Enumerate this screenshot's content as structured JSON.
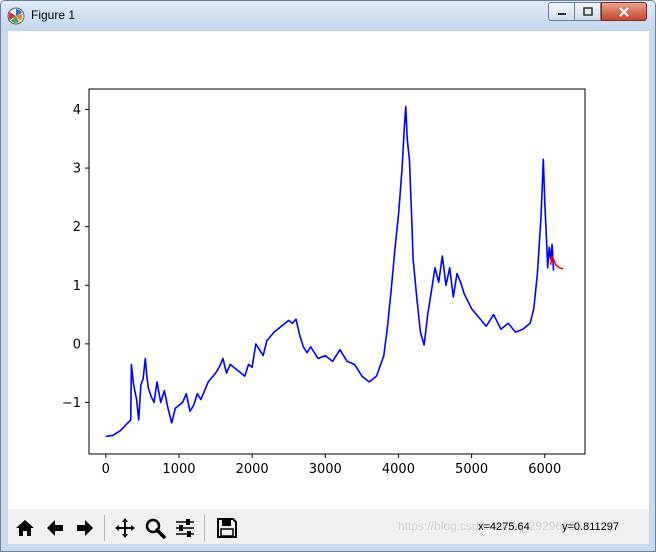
{
  "window": {
    "title": "Figure 1",
    "app_icon": "matplotlib-icon",
    "controls": [
      "minimize-icon",
      "maximize-icon",
      "close-icon"
    ]
  },
  "toolbar": {
    "buttons": [
      "home-icon",
      "back-arrow-icon",
      "forward-arrow-icon",
      "pan-icon",
      "zoom-icon",
      "configure-subplots-icon",
      "save-icon"
    ],
    "coord_x": "x=4275.64",
    "coord_y": "y=0.811297",
    "watermark": "https://blog.csdn.net/qq_29296886"
  },
  "chart_data": {
    "type": "line",
    "title": "",
    "xlabel": "",
    "ylabel": "",
    "xlim": [
      -230,
      6550
    ],
    "ylim": [
      -1.88,
      4.35
    ],
    "xticks": [
      0,
      1000,
      2000,
      3000,
      4000,
      5000,
      6000
    ],
    "yticks": [
      -1,
      0,
      1,
      2,
      3,
      4
    ],
    "xtick_labels": [
      "0",
      "1000",
      "2000",
      "3000",
      "4000",
      "5000",
      "6000"
    ],
    "ytick_labels": [
      "−1",
      "0",
      "1",
      "2",
      "3",
      "4"
    ],
    "grid": false,
    "legend": "none",
    "series": [
      {
        "color": "#0000ff",
        "x": [
          0,
          100,
          200,
          300,
          340,
          350,
          380,
          420,
          450,
          480,
          510,
          540,
          560,
          580,
          620,
          660,
          700,
          750,
          800,
          850,
          900,
          950,
          1000,
          1050,
          1100,
          1150,
          1200,
          1250,
          1300,
          1400,
          1500,
          1550,
          1600,
          1650,
          1700,
          1800,
          1900,
          1950,
          2000,
          2050,
          2100,
          2150,
          2200,
          2300,
          2400,
          2500,
          2550,
          2600,
          2650,
          2700,
          2750,
          2800,
          2900,
          3000,
          3100,
          3200,
          3300,
          3400,
          3500,
          3600,
          3700,
          3800,
          3850,
          3900,
          3950,
          4000,
          4050,
          4080,
          4100,
          4120,
          4150,
          4180,
          4200,
          4250,
          4300,
          4350,
          4400,
          4450,
          4500,
          4550,
          4600,
          4650,
          4700,
          4750,
          4800,
          4850,
          4900,
          5000,
          5100,
          5200,
          5300,
          5400,
          5500,
          5600,
          5700,
          5800,
          5850,
          5900,
          5950,
          5980,
          6000,
          6020,
          6040,
          6060,
          6080,
          6100,
          6120
        ],
        "y": [
          -1.58,
          -1.56,
          -1.48,
          -1.35,
          -1.3,
          -0.35,
          -0.7,
          -0.95,
          -1.3,
          -0.7,
          -0.6,
          -0.25,
          -0.55,
          -0.75,
          -0.9,
          -1.0,
          -0.65,
          -1.0,
          -0.8,
          -1.1,
          -1.35,
          -1.1,
          -1.05,
          -1.0,
          -0.85,
          -1.15,
          -1.05,
          -0.85,
          -0.95,
          -0.65,
          -0.5,
          -0.4,
          -0.25,
          -0.5,
          -0.35,
          -0.45,
          -0.55,
          -0.35,
          -0.4,
          0.0,
          -0.1,
          -0.2,
          0.05,
          0.2,
          0.3,
          0.4,
          0.35,
          0.42,
          0.15,
          -0.05,
          -0.15,
          -0.05,
          -0.25,
          -0.2,
          -0.3,
          -0.1,
          -0.3,
          -0.35,
          -0.55,
          -0.65,
          -0.55,
          -0.2,
          0.3,
          0.9,
          1.6,
          2.2,
          3.0,
          3.7,
          4.05,
          3.5,
          3.15,
          2.2,
          1.45,
          0.8,
          0.2,
          -0.02,
          0.5,
          0.9,
          1.3,
          1.05,
          1.5,
          1.0,
          1.3,
          0.8,
          1.2,
          1.05,
          0.85,
          0.6,
          0.45,
          0.3,
          0.5,
          0.25,
          0.35,
          0.2,
          0.25,
          0.35,
          0.6,
          1.2,
          2.2,
          3.15,
          2.4,
          1.9,
          1.3,
          1.65,
          1.45,
          1.7,
          1.25
        ]
      },
      {
        "color": "#ff0000",
        "x": [
          6080,
          6100,
          6120,
          6150,
          6200,
          6250
        ],
        "y": [
          1.35,
          1.5,
          1.45,
          1.35,
          1.3,
          1.28
        ]
      }
    ]
  }
}
